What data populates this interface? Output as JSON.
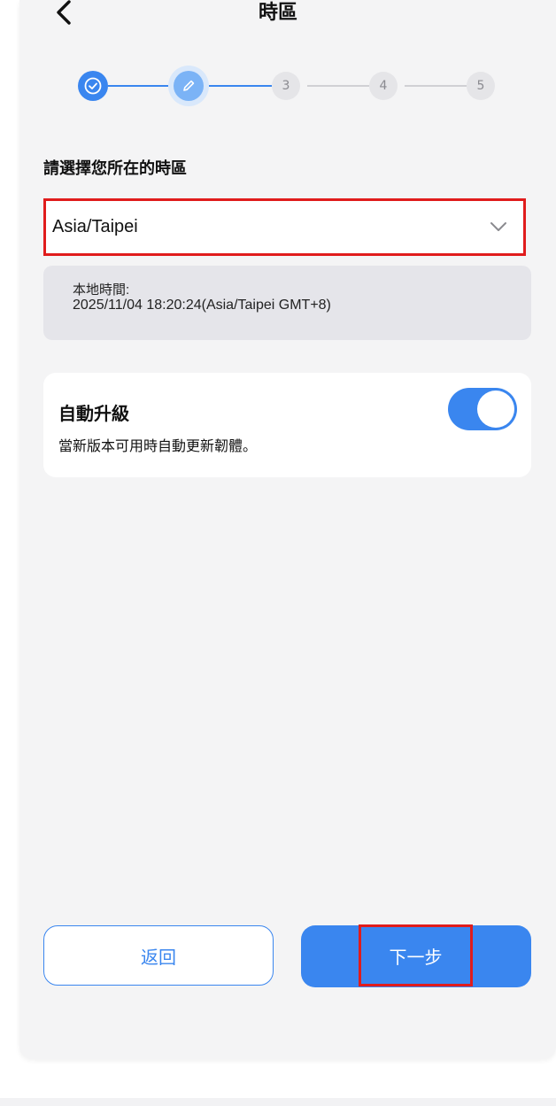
{
  "header": {
    "title": "時區",
    "back_icon": "chevron-left-icon"
  },
  "stepper": {
    "steps": [
      {
        "label": "",
        "state": "done",
        "icon": "check-circle-icon"
      },
      {
        "label": "",
        "state": "current",
        "icon": "pencil-icon"
      },
      {
        "label": "3",
        "state": "pending"
      },
      {
        "label": "4",
        "state": "pending"
      },
      {
        "label": "5",
        "state": "pending"
      }
    ]
  },
  "timezone": {
    "section_label": "請選擇您所在的時區",
    "selected": "Asia/Taipei",
    "local_time_label": "本地時間:",
    "local_time_value": "2025/11/04 18:20:24(Asia/Taipei GMT+8)"
  },
  "auto_upgrade": {
    "title": "自動升級",
    "description": "當新版本可用時自動更新韌體。",
    "enabled": true
  },
  "buttons": {
    "back_label": "返回",
    "next_label": "下一步"
  },
  "colors": {
    "accent": "#3a86ef",
    "highlight_border": "#e01c1c",
    "background": "#f4f4f5"
  }
}
